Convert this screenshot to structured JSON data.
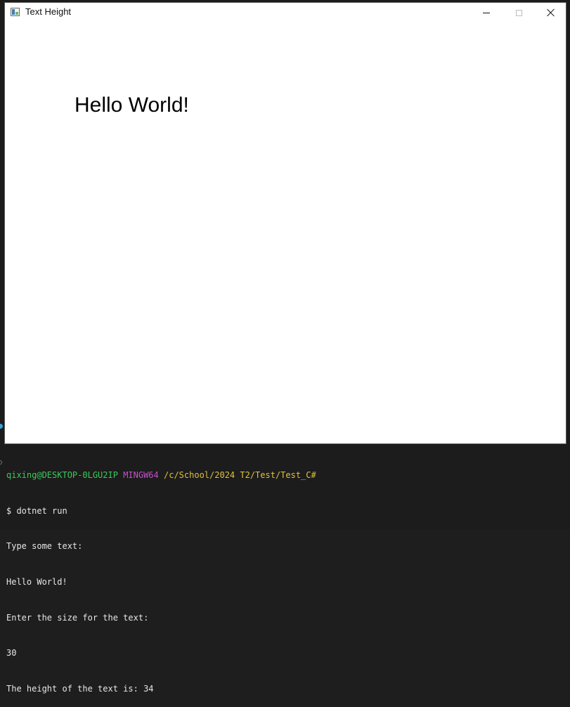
{
  "window": {
    "title": "Text Height",
    "icon": "app-window-icon",
    "controls": {
      "minimize": "minimize-icon",
      "maximize": "maximize-icon",
      "close": "close-icon"
    }
  },
  "canvas": {
    "text": "Hello World!"
  },
  "terminal": {
    "prompt": {
      "user_host": "qixing@DESKTOP-0LGU2IP",
      "shell": "MINGW64",
      "path": "/c/School/2024 T2/Test/Test_C#"
    },
    "lines": [
      "$ dotnet run",
      "Type some text:",
      "Hello World!",
      "Enter the size for the text:",
      "30",
      "The height of the text is: 34"
    ],
    "colors": {
      "user_host": "#3cc95b",
      "shell": "#c64fd0",
      "path": "#e0c13d",
      "text": "#e6e6e6",
      "background": "#1c1c1c"
    }
  }
}
